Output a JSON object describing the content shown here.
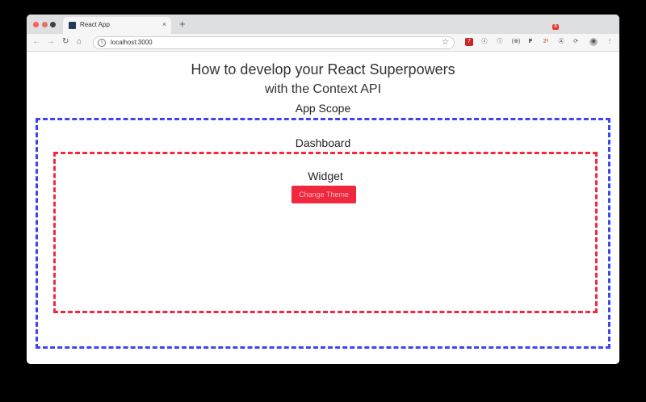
{
  "browser": {
    "tab": {
      "title": "React App",
      "close": "×"
    },
    "new_tab": "+",
    "nav": {
      "back": "←",
      "forward": "→",
      "reload": "↻",
      "home": "⌂"
    },
    "omnibox": {
      "url": "localhost:3000",
      "info_icon": "i",
      "star": "☆"
    },
    "extensions": [
      "7",
      "ⓒ",
      "(⊕)",
      "F",
      "2ᵒ",
      "Ⓐ",
      "⟳",
      "◉",
      "⋮"
    ],
    "badge": "8"
  },
  "page": {
    "title": "How to develop your React Superpowers",
    "subtitle": "with the Context API",
    "app_scope": "App Scope",
    "dashboard": "Dashboard",
    "widget": "Widget",
    "change_theme": "Change Theme"
  },
  "colors": {
    "app_border": "#3d45f0",
    "dashboard_border": "#ef2b3f",
    "button_bg": "#f0283e"
  }
}
